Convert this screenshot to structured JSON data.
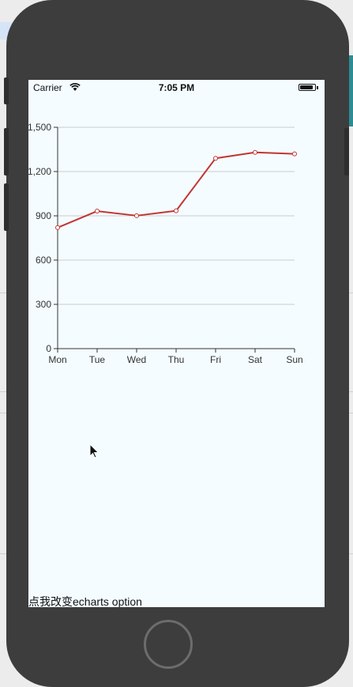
{
  "status_bar": {
    "carrier": "Carrier",
    "time": "7:05 PM",
    "battery_level": 0.9
  },
  "button": {
    "label": "点我改变echarts option"
  },
  "colors": {
    "series": "#c23531",
    "grid": "#cccccc",
    "axis": "#333333",
    "screen_bg": "#f4fcff"
  },
  "chart_data": {
    "type": "line",
    "categories": [
      "Mon",
      "Tue",
      "Wed",
      "Thu",
      "Fri",
      "Sat",
      "Sun"
    ],
    "series": [
      {
        "values": [
          820,
          932,
          901,
          934,
          1290,
          1330,
          1320
        ]
      }
    ],
    "ylim": [
      0,
      1500
    ],
    "y_ticks": [
      "0",
      "300",
      "600",
      "900",
      "1,200",
      "1,500"
    ],
    "y_tick_values": [
      0,
      300,
      600,
      900,
      1200,
      1500
    ],
    "grid": true
  }
}
